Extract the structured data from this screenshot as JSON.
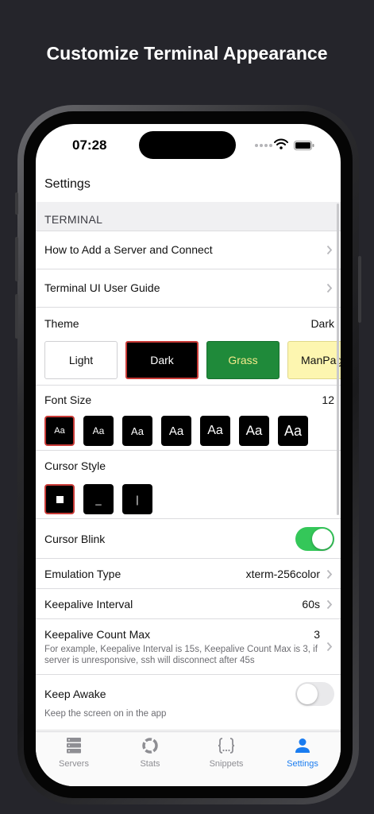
{
  "headline": "Customize Terminal Appearance",
  "status_bar": {
    "time": "07:28"
  },
  "nav": {
    "title": "Settings"
  },
  "section": {
    "title": "TERMINAL"
  },
  "rows": {
    "how_to_add": "How to Add a Server and Connect",
    "ui_guide": "Terminal UI User Guide"
  },
  "theme": {
    "label": "Theme",
    "value": "Dark",
    "options": [
      {
        "name": "Light",
        "bg": "#ffffff",
        "fg": "#111111"
      },
      {
        "name": "Dark",
        "bg": "#000000",
        "fg": "#ffffff",
        "selected": true
      },
      {
        "name": "Grass",
        "bg": "#1f8a3a",
        "fg": "#f3e98a"
      },
      {
        "name": "ManPage",
        "bg": "#fdf6b0",
        "fg": "#111111"
      }
    ]
  },
  "font_size": {
    "label": "Font Size",
    "value": "12",
    "sample": "Aa",
    "selected_index": 0
  },
  "cursor_style": {
    "label": "Cursor Style",
    "options": [
      "block",
      "underline",
      "bar"
    ],
    "selected_index": 0,
    "underline_glyph": "_",
    "bar_glyph": "|"
  },
  "cursor_blink": {
    "label": "Cursor Blink",
    "on": true
  },
  "emulation": {
    "label": "Emulation Type",
    "value": "xterm-256color"
  },
  "keepalive_interval": {
    "label": "Keepalive Interval",
    "value": "60s"
  },
  "keepalive_count": {
    "label": "Keepalive Count Max",
    "value": "3",
    "note": "For example, Keepalive Interval is 15s, Keepalive Count Max is 3, if server is unresponsive, ssh will disconnect after 45s"
  },
  "keep_awake": {
    "label": "Keep Awake",
    "note": "Keep the screen on in the app",
    "on": false
  },
  "tabs": [
    {
      "label": "Servers",
      "icon": "server-icon"
    },
    {
      "label": "Stats",
      "icon": "stats-icon"
    },
    {
      "label": "Snippets",
      "icon": "snippets-icon"
    },
    {
      "label": "Settings",
      "icon": "person-icon",
      "active": true
    }
  ],
  "colors": {
    "accent": "#1a7cf0",
    "toggle_on": "#34c759",
    "selected_border": "#c83a36"
  }
}
